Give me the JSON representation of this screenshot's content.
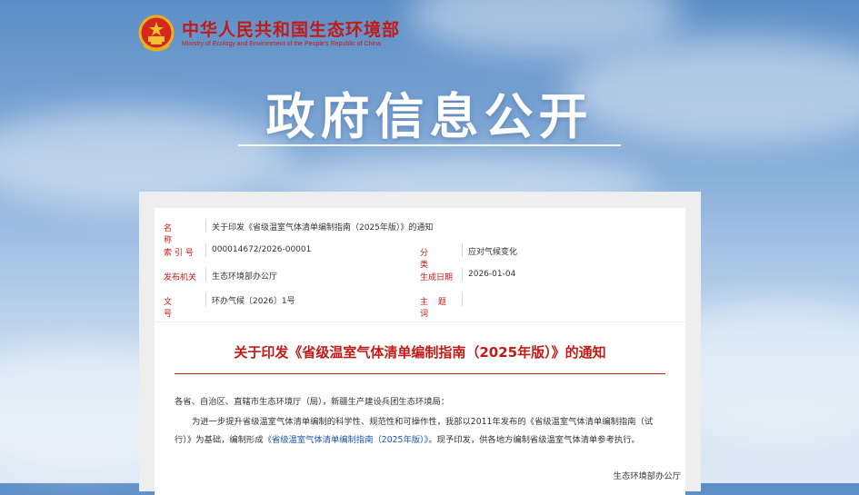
{
  "header": {
    "ministry_cn": "中华人民共和国生态环境部",
    "ministry_en": "Ministry of Ecology and Environment of the People's Republic of China"
  },
  "banner": {
    "title": "政府信息公开"
  },
  "meta": {
    "name_label": "名 称",
    "name_value": "关于印发《省级温室气体清单编制指南（2025年版）》的通知",
    "index_label": "索 引 号",
    "index_value": "000014672/2026-00001",
    "category_label": "分 类",
    "category_value": "应对气候变化",
    "issuer_label": "发布机关",
    "issuer_value": "生态环境部办公厅",
    "date_label": "生成日期",
    "date_value": "2026-01-04",
    "doc_no_label": "文 号",
    "doc_no_value": "环办气候〔2026〕1号",
    "subject_label": "主 题 词",
    "subject_value": ""
  },
  "document": {
    "title": "关于印发《省级温室气体清单编制指南（2025年版）》的通知",
    "addressee": "各省、自治区、直辖市生态环境厅（局），新疆生产建设兵团生态环境局：",
    "body_part1": "为进一步提升省级温室气体清单编制的科学性、规范性和可操作性，我部以2011年发布的《省级温室气体清单编制",
    "body_part2": "指南（试行）》为基础，编制形成",
    "body_link": "《省级温室气体清单编制指南（2025年版）》",
    "body_part3": "。现予印发，供各地方编制省级温室气",
    "body_part4": "体清单参考执行。",
    "signoff": "生态环境部办公厅"
  },
  "colors": {
    "accent_red": "#c41a16",
    "link_blue": "#1a56b0"
  }
}
